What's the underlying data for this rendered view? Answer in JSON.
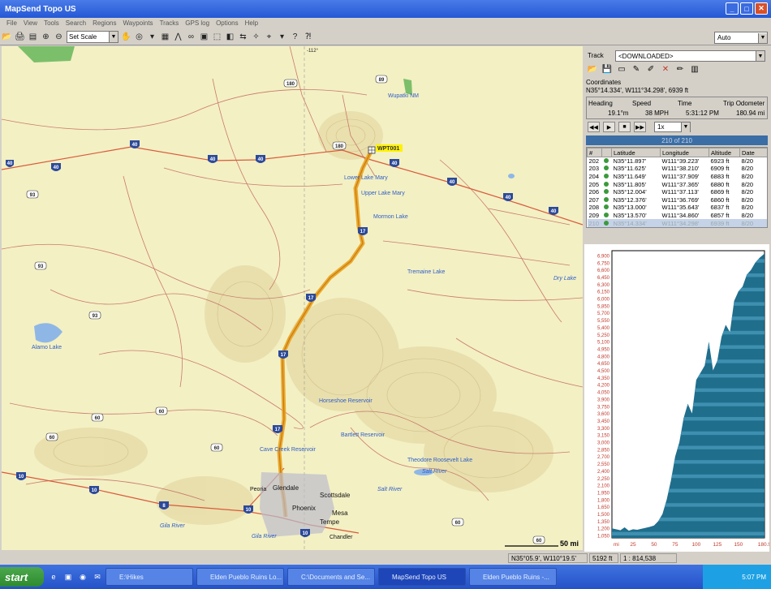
{
  "app": {
    "title": "MapSend Topo US",
    "win_min": "_",
    "win_max": "□",
    "win_close": "✕"
  },
  "menu": [
    "File",
    "View",
    "Tools",
    "Search",
    "Regions",
    "Waypoints",
    "Tracks",
    "GPS log",
    "Options",
    "Help"
  ],
  "toolbar": {
    "scale_value": "Set Scale",
    "mode_value": "Auto"
  },
  "map": {
    "grid_label": "-112°",
    "scale_bar": "50 mi",
    "waypoint_label": "WPT001",
    "route_color": "#e8a21a",
    "shields": {
      "i40": "40",
      "i17": "17",
      "i10": "10",
      "i8": "8",
      "us89": "89",
      "us180": "180",
      "us93": "93",
      "us60": "60"
    },
    "labels": {
      "wupatki": "Wupatki NM",
      "lower_lake_mary": "Lower Lake Mary",
      "upper_lake_mary": "Upper Lake Mary",
      "mormon_lake": "Mormon Lake",
      "tremaine_lake": "Tremaine Lake",
      "dry_lake": "Dry Lake",
      "alamo_lake": "Alamo Lake",
      "horseshoe": "Horseshoe Reservoir",
      "bartlett": "Bartlett Reservoir",
      "cave_creek": "Cave Creek Reservoir",
      "roosevelt": "Theodore Roosevelt Lake",
      "salt_river_1": "Salt River",
      "salt_river_2": "Salt River",
      "gila_river_1": "Gila River",
      "gila_river_2": "Gila River",
      "glendale": "Glendale",
      "peoria": "Peoria",
      "scottsdale": "Scottsdale",
      "phoenix": "Phoenix",
      "mesa": "Mesa",
      "tempe": "Tempe",
      "chandler": "Chandler"
    }
  },
  "panel": {
    "track_label": "Track",
    "track_value": "<DOWNLOADED>",
    "coordinates_label": "Coordinates",
    "coordinates_value": "N35°14.334', W111°34.298', 6939 ft",
    "heading_label": "Heading",
    "heading_value": "19.1°m",
    "speed_label": "Speed",
    "speed_value": "38 MPH",
    "time_label": "Time",
    "time_value": "5:31:12 PM",
    "odometer_label": "Trip Odometer",
    "odometer_value": "180.94 mi",
    "playback_speed": "1x",
    "point_count": "210 of 210",
    "columns": [
      "#",
      "",
      "Latitude",
      "Longitude",
      "Altitude",
      "Date"
    ],
    "rows": [
      {
        "n": "202",
        "lat": "N35°11.897'",
        "lon": "W111°39.223'",
        "alt": "6923 ft",
        "date": "8/20"
      },
      {
        "n": "203",
        "lat": "N35°11.625'",
        "lon": "W111°38.210'",
        "alt": "6909 ft",
        "date": "8/20"
      },
      {
        "n": "204",
        "lat": "N35°11.649'",
        "lon": "W111°37.909'",
        "alt": "6883 ft",
        "date": "8/20"
      },
      {
        "n": "205",
        "lat": "N35°11.805'",
        "lon": "W111°37.365'",
        "alt": "6880 ft",
        "date": "8/20"
      },
      {
        "n": "206",
        "lat": "N35°12.004'",
        "lon": "W111°37.113'",
        "alt": "6869 ft",
        "date": "8/20"
      },
      {
        "n": "207",
        "lat": "N35°12.376'",
        "lon": "W111°36.769'",
        "alt": "6860 ft",
        "date": "8/20"
      },
      {
        "n": "208",
        "lat": "N35°13.000'",
        "lon": "W111°35.643'",
        "alt": "6837 ft",
        "date": "8/20"
      },
      {
        "n": "209",
        "lat": "N35°13.570'",
        "lon": "W111°34.860'",
        "alt": "6857 ft",
        "date": "8/20"
      },
      {
        "n": "210",
        "lat": "N35°14.334'",
        "lon": "W111°34.298'",
        "alt": "6939 ft",
        "date": "8/20"
      }
    ]
  },
  "chart_data": {
    "type": "area",
    "title": "",
    "xlabel": "",
    "ylabel": "",
    "x_unit": "mi",
    "xlim": [
      0,
      181
    ],
    "ylim": [
      1000,
      7000
    ],
    "x_ticks": [
      25,
      50,
      75,
      100,
      125,
      150,
      180.9
    ],
    "y_ticks": [
      1050,
      1200,
      1350,
      1500,
      1650,
      1800,
      1950,
      2100,
      2250,
      2400,
      2550,
      2700,
      2850,
      3000,
      3150,
      3300,
      3450,
      3600,
      3750,
      3900,
      4050,
      4200,
      4350,
      4500,
      4650,
      4800,
      4950,
      5100,
      5250,
      5400,
      5550,
      5700,
      5850,
      6000,
      6150,
      6300,
      6450,
      6600,
      6750,
      6900
    ],
    "y_tick_labels": [
      "1,050",
      "1,200",
      "1,350",
      "1,500",
      "1,650",
      "1,800",
      "1,950",
      "2,100",
      "2,250",
      "2,400",
      "2,550",
      "2,700",
      "2,850",
      "3,000",
      "3,150",
      "3,300",
      "3,450",
      "3,600",
      "3,750",
      "3,900",
      "4,050",
      "4,200",
      "4,350",
      "4,500",
      "4,650",
      "4,800",
      "4,950",
      "5,100",
      "5,250",
      "5,400",
      "5,550",
      "5,700",
      "5,850",
      "6,000",
      "6,150",
      "6,300",
      "6,450",
      "6,600",
      "6,750",
      "6,900"
    ],
    "fill_color": "#1f6e8c",
    "band_color": "#3e8fb0",
    "tick_color": "#c0392b",
    "x": [
      0,
      5,
      10,
      15,
      20,
      25,
      30,
      35,
      40,
      45,
      50,
      55,
      60,
      65,
      70,
      75,
      80,
      85,
      90,
      95,
      100,
      105,
      110,
      115,
      120,
      125,
      130,
      135,
      140,
      145,
      150,
      155,
      160,
      165,
      170,
      175,
      180.9
    ],
    "values": [
      1200,
      1180,
      1160,
      1220,
      1150,
      1180,
      1170,
      1190,
      1210,
      1230,
      1260,
      1350,
      1500,
      1800,
      2200,
      2700,
      3000,
      3500,
      3800,
      3600,
      4300,
      4450,
      4600,
      5100,
      4500,
      4700,
      5200,
      5450,
      5300,
      5950,
      6150,
      6250,
      6500,
      6600,
      6750,
      6850,
      6939
    ]
  },
  "status": {
    "coords": "N35°05.9', W110°19.5'",
    "elevation": "5192 ft",
    "scale": "1 : 814,538"
  },
  "taskbar": {
    "start": "start",
    "tasks": [
      "E:\\Hikes",
      "Elden Pueblo Ruins Lo...",
      "C:\\Documents and Se...",
      "MapSend Topo US",
      "Elden Pueblo Ruins -..."
    ],
    "clock": "5:07 PM"
  }
}
